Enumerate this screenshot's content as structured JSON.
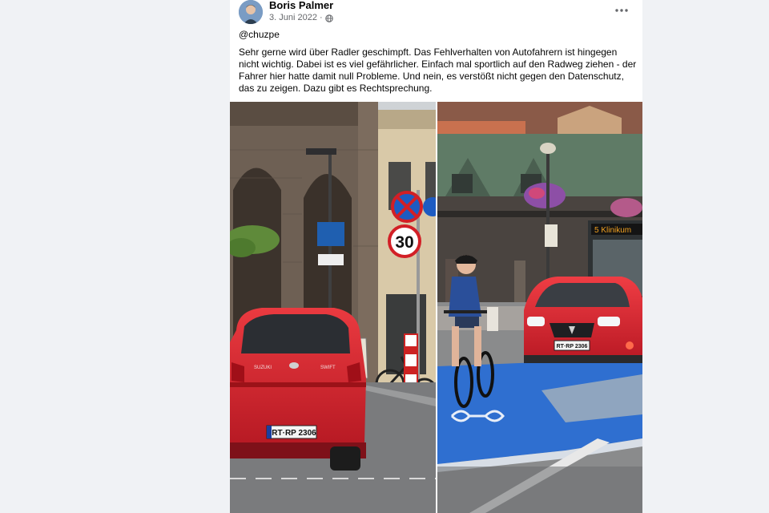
{
  "post": {
    "author": "Boris Palmer",
    "date": "3. Juni 2022 ·",
    "privacy_icon": "globe-icon",
    "menu_icon": "more-horizontal-icon",
    "mention": "@chuzpe",
    "text": "Sehr gerne wird über Radler geschimpft. Das Fehlverhalten von Autofahrern ist hingegen nicht wichtig. Dabei ist es viel gefährlicher. Einfach mal sportlich auf den Radweg ziehen - der Fahrer hier hatte damit null Probleme. Und nein, es verstößt nicht gegen den Datenschutz, das zu zeigen. Dazu gibt es Rechtsprechung."
  },
  "photos": {
    "left": {
      "speed_sign": "30",
      "license_plate": "RT·RP 2306",
      "car_badge": "SUZUKI",
      "car_model": "SWIFT"
    },
    "right": {
      "bus_display": "5 Klinikum",
      "license_plate": "RT·RP 2306"
    }
  },
  "colors": {
    "background": "#f0f2f5",
    "card": "#ffffff",
    "secondary_text": "#65676b",
    "car_red": "#d8232f",
    "bike_lane_blue": "#2f6fd0"
  }
}
